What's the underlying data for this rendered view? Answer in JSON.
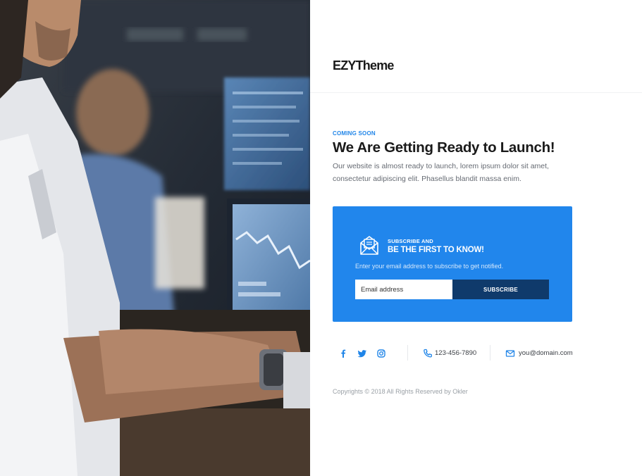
{
  "brand": {
    "logo_text": "EZYTheme"
  },
  "hero": {
    "eyebrow": "COMING SOON",
    "title": "We Are Getting Ready to Launch!",
    "lead": "Our website is almost ready to launch, lorem ipsum dolor sit amet, consectetur adipiscing elit. Phasellus blandit massa enim."
  },
  "subscribe": {
    "eyebrow": "SUBSCRIBE AND",
    "title": "BE THE FIRST TO KNOW!",
    "hint": "Enter your email address to subscribe to get notified.",
    "input_placeholder": "Email address",
    "button_label": "SUBSCRIBE",
    "box_color": "#2186ec",
    "button_color": "#0f3a6b"
  },
  "contact": {
    "social": [
      "facebook-icon",
      "twitter-icon",
      "instagram-icon"
    ],
    "phone": "123-456-7890",
    "email": "you@domain.com",
    "icon_color": "#2085e8"
  },
  "footer": {
    "copyright": "Copyrights © 2018 All Rights Reserved by Okler"
  }
}
